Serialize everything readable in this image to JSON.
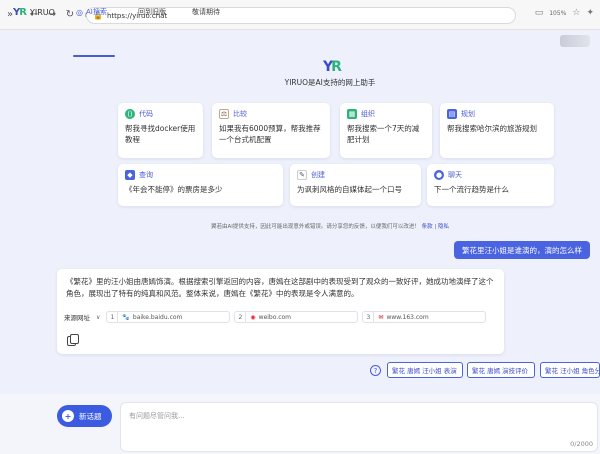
{
  "browser": {
    "url": "https://yiruo.chat",
    "zoom": "105%"
  },
  "header": {
    "logo_mark_y": "Y",
    "logo_mark_r": "R",
    "logo_text": "YIRUO",
    "tabs": [
      {
        "label": "AI搜索",
        "active": true
      },
      {
        "label": "回到旧版",
        "active": false
      },
      {
        "label": "敬请期待",
        "active": false
      }
    ]
  },
  "hero": {
    "logo_y": "Y",
    "logo_r": "R",
    "subtitle": "YIRUO是AI支持的网上助手"
  },
  "cards": [
    {
      "tag": "代码",
      "icon": "code-icon",
      "color": "#2ab37a",
      "text": "帮我寻找docker使用教程"
    },
    {
      "tag": "比较",
      "icon": "scale-icon",
      "color": "#7a5a3a",
      "text": "如果我有6000预算，帮我推荐一个台式机配置"
    },
    {
      "tag": "组织",
      "icon": "grid-icon",
      "color": "#2ab37a",
      "text": "帮我搜索一个7天的减肥计划"
    },
    {
      "tag": "规划",
      "icon": "calendar-icon",
      "color": "#4a63e0",
      "text": "帮我搜索哈尔滨的旅游规划"
    },
    {
      "tag": "查询",
      "icon": "tag-icon",
      "color": "#4a63e0",
      "text": "《年会不能停》的票房是多少"
    },
    {
      "tag": "创建",
      "icon": "wand-icon",
      "color": "#555555",
      "text": "为讽刺风格的自媒体起一个口号"
    },
    {
      "tag": "聊天",
      "icon": "chat-icon",
      "color": "#4a63e0",
      "text": "下一个流行趋势是什么"
    }
  ],
  "disclaimer": {
    "text": "翼若由AI提供支持，因此可能出现意外或错误。请分享您的反馈，以便我们可以改进！",
    "terms": "条款",
    "privacy": "隐私"
  },
  "chat": {
    "user_message": "繁花里汪小姐是谁演的，演的怎么样",
    "answer": "《繁花》里的汪小姐由唐嫣饰演。根据搜索引擎返回的内容，唐嫣在这部剧中的表现受到了观众的一致好评，她成功地演绎了这个角色，展现出了特有的纯真和风范。整体来说，唐嫣在《繁花》中的表现是令人满意的。",
    "sources_label": "来源网址",
    "sources": [
      {
        "num": "1",
        "icon": "paw-icon",
        "site": "baike.baidu.com"
      },
      {
        "num": "2",
        "icon": "weibo-icon",
        "site": "weibo.com"
      },
      {
        "num": "3",
        "icon": "mail-icon",
        "site": "www.163.com"
      }
    ],
    "suggestions": [
      "繁花 唐嫣 汪小姐 表演",
      "繁花 唐嫣 演技评价",
      "繁花 汪小姐 角色分析"
    ]
  },
  "composer": {
    "new_topic_label": "新话题",
    "placeholder": "有问题尽管问我...",
    "counter": "0/2000"
  }
}
